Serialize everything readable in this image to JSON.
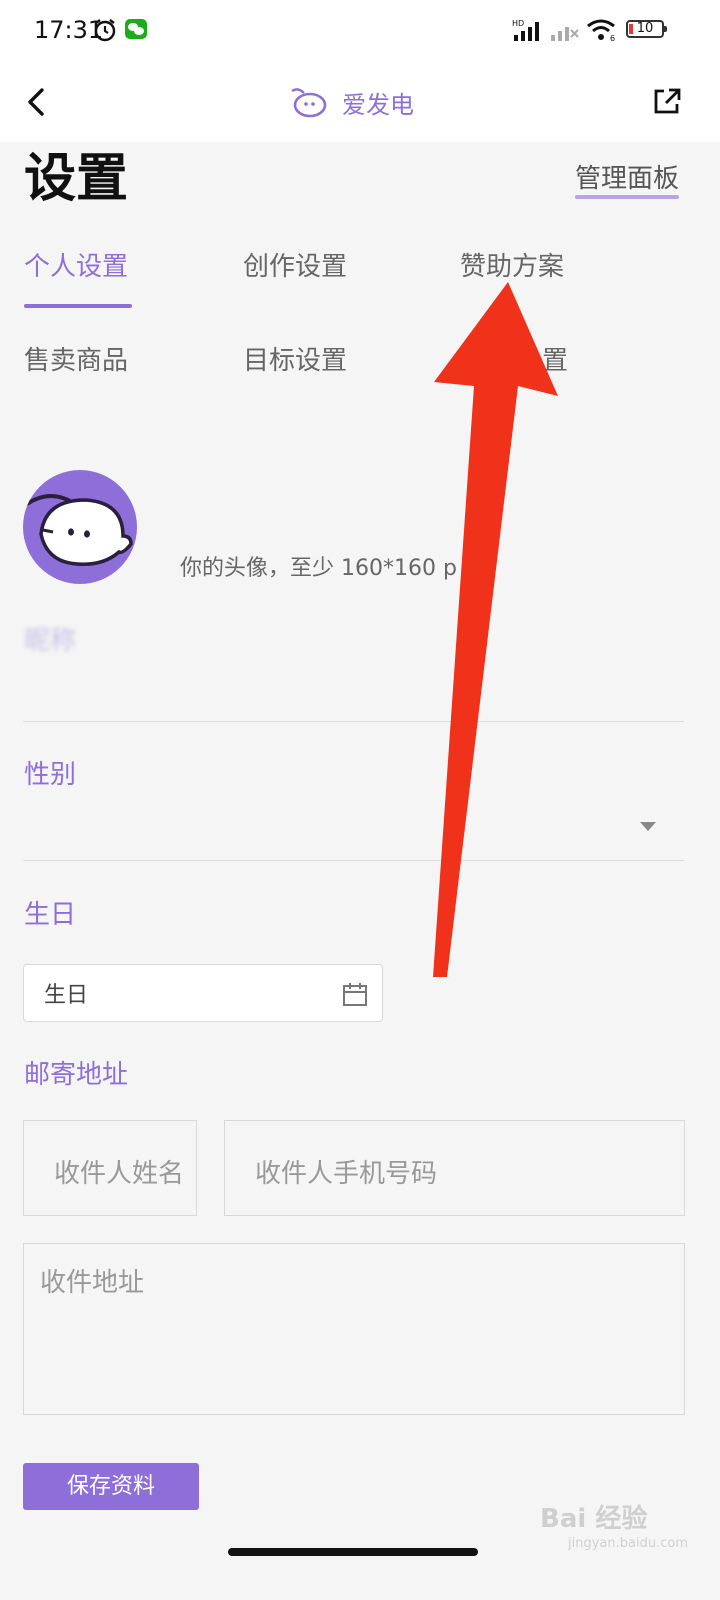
{
  "status_bar": {
    "time": "17:31",
    "battery": "10"
  },
  "header": {
    "brand_name": "爱发电"
  },
  "page": {
    "title": "设置",
    "manage_panel": "管理面板"
  },
  "tabs": [
    {
      "label": "个人设置",
      "active": true
    },
    {
      "label": "创作设置",
      "active": false
    },
    {
      "label": "赞助方案",
      "active": false
    },
    {
      "label": "售卖商品",
      "active": false
    },
    {
      "label": "目标设置",
      "active": false
    },
    {
      "label": "置",
      "active": false
    }
  ],
  "avatar": {
    "hint": "你的头像，至少 160*160 p"
  },
  "nickname": {
    "label": "昵称"
  },
  "gender": {
    "label": "性别",
    "value": ""
  },
  "birthday": {
    "label": "生日",
    "placeholder": "生日"
  },
  "address": {
    "label": "邮寄地址",
    "recipient_name_placeholder": "收件人姓名",
    "recipient_phone_placeholder": "收件人手机号码",
    "address_placeholder": "收件地址"
  },
  "save_button": "保存资料",
  "watermark": {
    "text": "Bai 经验",
    "sub": "jingyan.baidu.com"
  },
  "colors": {
    "accent": "#8e6fd9",
    "arrow": "#f0321a",
    "background": "#f5f5f5"
  }
}
